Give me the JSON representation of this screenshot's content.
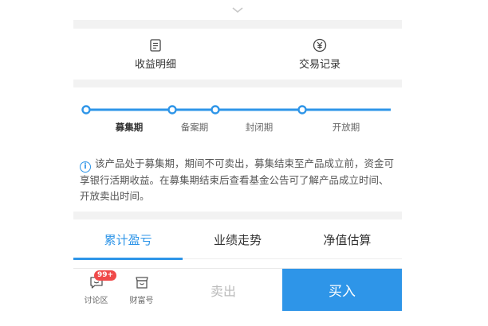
{
  "icons": {
    "collapse": "chevron-down-icon",
    "income_detail": "document-icon",
    "trade_records": "yen-coin-icon",
    "notice": "info-icon",
    "discussion": "chat-bubble-icon",
    "wealth": "store-icon"
  },
  "colors": {
    "accent": "#2e95e8",
    "badge": "#f04a4a",
    "disabled_text": "#bbbbbb"
  },
  "shortcuts": {
    "income_detail": "收益明细",
    "trade_records": "交易记录"
  },
  "timeline": {
    "stages": [
      "募集期",
      "备案期",
      "封闭期",
      "开放期"
    ],
    "active_index": 0
  },
  "notice": {
    "text": "该产品处于募集期，期间不可卖出，募集结束至产品成立前，资金可享银行活期收益。在募集期结束后查看基金公告可了解产品成立时间、开放卖出时间。"
  },
  "tabs": {
    "items": [
      "累计盈亏",
      "业绩走势",
      "净值估算"
    ],
    "active_index": 0
  },
  "bottom_bar": {
    "discussion_label": "讨论区",
    "discussion_badge": "99+",
    "wealth_label": "财富号",
    "sell_label": "卖出",
    "buy_label": "买入"
  }
}
